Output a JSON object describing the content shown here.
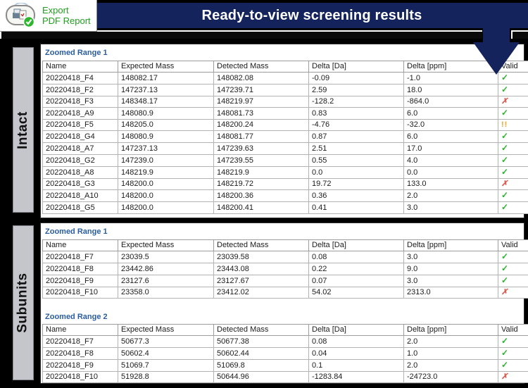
{
  "export_button": {
    "line1": "Export",
    "line2": "PDF Report"
  },
  "banner": {
    "title": "Ready-to-view screening results"
  },
  "valid_glyphs": {
    "valid": "✓",
    "invalid": "✗",
    "warning": "!!"
  },
  "colors": {
    "banner_bg": "#14235c",
    "range_title_blue": "#2a5d9f",
    "export_green": "#1ea11e",
    "valid_green": "#2db52d",
    "invalid_red": "#e0564a",
    "warning_orange": "#ff9f1e",
    "section_label_bg": "#c5c5cc"
  },
  "panels": [
    {
      "section_label": "Intact",
      "tables": [
        {
          "title": "Zoomed Range 1",
          "columns": [
            "Name",
            "Expected Mass",
            "Detected Mass",
            "Delta [Da]",
            "Delta [ppm]",
            "Valid"
          ],
          "rows": [
            [
              "20220418_F4",
              "148082.17",
              "148082.08",
              "-0.09",
              "-1.0",
              "valid"
            ],
            [
              "20220418_F2",
              "147237.13",
              "147239.71",
              "2.59",
              "18.0",
              "valid"
            ],
            [
              "20220418_F3",
              "148348.17",
              "148219.97",
              "-128.2",
              "-864.0",
              "invalid"
            ],
            [
              "20220418_A9",
              "148080.9",
              "148081.73",
              "0.83",
              "6.0",
              "valid"
            ],
            [
              "20220418_F5",
              "148205.0",
              "148200.24",
              "-4.76",
              "-32.0",
              "warning"
            ],
            [
              "20220418_G4",
              "148080.9",
              "148081.77",
              "0.87",
              "6.0",
              "valid"
            ],
            [
              "20220418_A7",
              "147237.13",
              "147239.63",
              "2.51",
              "17.0",
              "valid"
            ],
            [
              "20220418_G2",
              "147239.0",
              "147239.55",
              "0.55",
              "4.0",
              "valid"
            ],
            [
              "20220418_A8",
              "148219.9",
              "148219.9",
              "0.0",
              "0.0",
              "valid"
            ],
            [
              "20220418_G3",
              "148200.0",
              "148219.72",
              "19.72",
              "133.0",
              "invalid"
            ],
            [
              "20220418_A10",
              "148200.0",
              "148200.36",
              "0.36",
              "2.0",
              "valid"
            ],
            [
              "20220418_G5",
              "148200.0",
              "148200.41",
              "0.41",
              "3.0",
              "valid"
            ]
          ]
        }
      ]
    },
    {
      "section_label": "Subunits",
      "tables": [
        {
          "title": "Zoomed Range 1",
          "columns": [
            "Name",
            "Expected Mass",
            "Detected Mass",
            "Delta [Da]",
            "Delta [ppm]",
            "Valid"
          ],
          "rows": [
            [
              "20220418_F7",
              "23039.5",
              "23039.58",
              "0.08",
              "3.0",
              "valid"
            ],
            [
              "20220418_F8",
              "23442.86",
              "23443.08",
              "0.22",
              "9.0",
              "valid"
            ],
            [
              "20220418_F9",
              "23127.6",
              "23127.67",
              "0.07",
              "3.0",
              "valid"
            ],
            [
              "20220418_F10",
              "23358.0",
              "23412.02",
              "54.02",
              "2313.0",
              "invalid"
            ]
          ]
        },
        {
          "title": "Zoomed Range 2",
          "columns": [
            "Name",
            "Expected Mass",
            "Detected Mass",
            "Delta [Da]",
            "Delta [ppm]",
            "Valid"
          ],
          "rows": [
            [
              "20220418_F7",
              "50677.3",
              "50677.38",
              "0.08",
              "2.0",
              "valid"
            ],
            [
              "20220418_F8",
              "50602.4",
              "50602.44",
              "0.04",
              "1.0",
              "valid"
            ],
            [
              "20220418_F9",
              "51069.7",
              "51069.8",
              "0.1",
              "2.0",
              "valid"
            ],
            [
              "20220418_F10",
              "51928.8",
              "50644.96",
              "-1283.84",
              "-24723.0",
              "invalid"
            ]
          ]
        }
      ]
    }
  ]
}
